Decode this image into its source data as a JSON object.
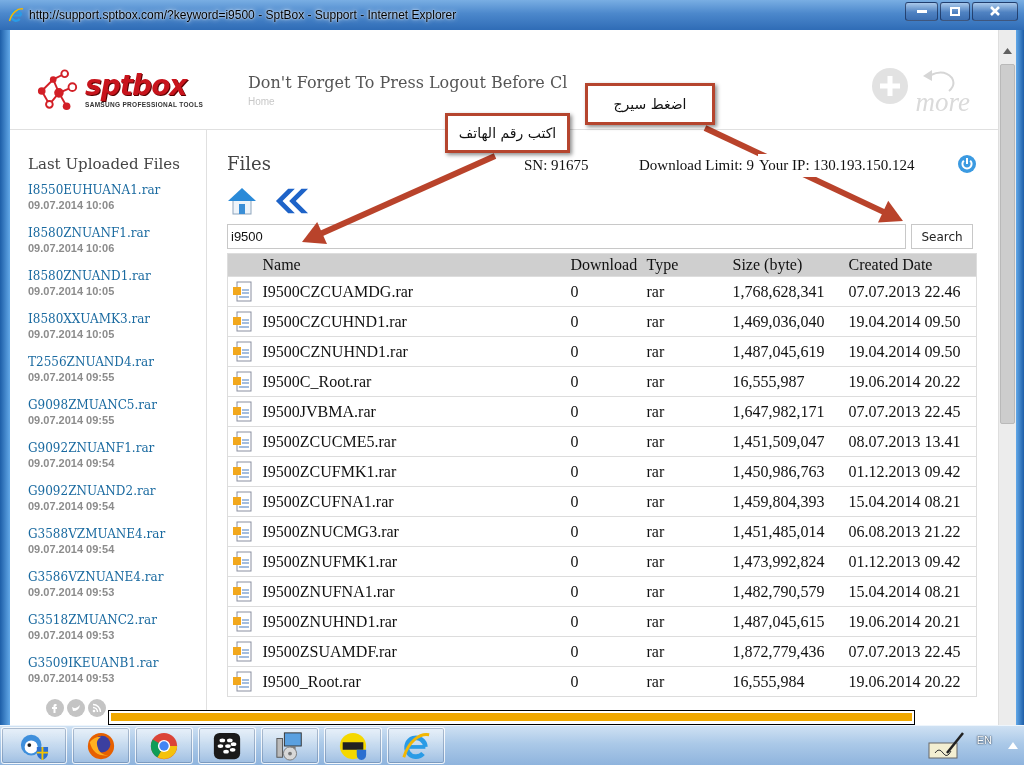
{
  "window": {
    "title": "http://support.sptbox.com/?keyword=i9500 - SptBox - Support - Internet Explorer"
  },
  "header": {
    "logo_text": "sptbox",
    "logo_tagline": "SAMSUNG PROFESSIONAL TOOLS",
    "notice": "Don't Forget To Press Logout Before Cl",
    "breadcrumb": "Home",
    "more_label": "more"
  },
  "sidebar": {
    "title": "Last Uploaded Files",
    "items": [
      {
        "name": "I8550EUHUANA1.rar",
        "date": "09.07.2014 10:06"
      },
      {
        "name": "I8580ZNUANF1.rar",
        "date": "09.07.2014 10:06"
      },
      {
        "name": "I8580ZNUAND1.rar",
        "date": "09.07.2014 10:05"
      },
      {
        "name": "I8580XXUAMK3.rar",
        "date": "09.07.2014 10:05"
      },
      {
        "name": "T2556ZNUAND4.rar",
        "date": "09.07.2014 09:55"
      },
      {
        "name": "G9098ZMUANC5.rar",
        "date": "09.07.2014 09:55"
      },
      {
        "name": "G9092ZNUANF1.rar",
        "date": "09.07.2014 09:54"
      },
      {
        "name": "G9092ZNUAND2.rar",
        "date": "09.07.2014 09:54"
      },
      {
        "name": "G3588VZMUANE4.rar",
        "date": "09.07.2014 09:54"
      },
      {
        "name": "G3586VZNUANE4.rar",
        "date": "09.07.2014 09:53"
      },
      {
        "name": "G3518ZMUANC2.rar",
        "date": "09.07.2014 09:53"
      },
      {
        "name": "G3509IKEUANB1.rar",
        "date": "09.07.2014 09:53"
      }
    ]
  },
  "main": {
    "title": "Files",
    "serial": "SN: 91675",
    "download_limit": "Download Limit: 9",
    "ip": "Your IP: 130.193.150.124",
    "search": {
      "value": "i9500",
      "button": "Search"
    }
  },
  "table": {
    "columns": [
      "Name",
      "Download",
      "Type",
      "Size (byte)",
      "Created Date"
    ],
    "rows": [
      {
        "name": "I9500CZCUAMDG.rar",
        "downloads": "0",
        "type": "rar",
        "size": "1,768,628,341",
        "created": "07.07.2013 22.46"
      },
      {
        "name": "I9500CZCUHND1.rar",
        "downloads": "0",
        "type": "rar",
        "size": "1,469,036,040",
        "created": "19.04.2014 09.50"
      },
      {
        "name": "I9500CZNUHND1.rar",
        "downloads": "0",
        "type": "rar",
        "size": "1,487,045,619",
        "created": "19.04.2014 09.50"
      },
      {
        "name": "I9500C_Root.rar",
        "downloads": "0",
        "type": "rar",
        "size": "16,555,987",
        "created": "19.06.2014 20.22"
      },
      {
        "name": "I9500JVBMA.rar",
        "downloads": "0",
        "type": "rar",
        "size": "1,647,982,171",
        "created": "07.07.2013 22.45"
      },
      {
        "name": "I9500ZCUCME5.rar",
        "downloads": "0",
        "type": "rar",
        "size": "1,451,509,047",
        "created": "08.07.2013 13.41"
      },
      {
        "name": "I9500ZCUFMK1.rar",
        "downloads": "0",
        "type": "rar",
        "size": "1,450,986,763",
        "created": "01.12.2013 09.42"
      },
      {
        "name": "I9500ZCUFNA1.rar",
        "downloads": "0",
        "type": "rar",
        "size": "1,459,804,393",
        "created": "15.04.2014 08.21"
      },
      {
        "name": "I9500ZNUCMG3.rar",
        "downloads": "0",
        "type": "rar",
        "size": "1,451,485,014",
        "created": "06.08.2013 21.22"
      },
      {
        "name": "I9500ZNUFMK1.rar",
        "downloads": "0",
        "type": "rar",
        "size": "1,473,992,824",
        "created": "01.12.2013 09.42"
      },
      {
        "name": "I9500ZNUFNA1.rar",
        "downloads": "0",
        "type": "rar",
        "size": "1,482,790,579",
        "created": "15.04.2014 08.21"
      },
      {
        "name": "I9500ZNUHND1.rar",
        "downloads": "0",
        "type": "rar",
        "size": "1,487,045,615",
        "created": "19.06.2014 20.21"
      },
      {
        "name": "I9500ZSUAMDF.rar",
        "downloads": "0",
        "type": "rar",
        "size": "1,872,779,436",
        "created": "07.07.2013 22.45"
      },
      {
        "name": "I9500_Root.rar",
        "downloads": "0",
        "type": "rar",
        "size": "16,555,984",
        "created": "19.06.2014 20.22"
      }
    ]
  },
  "annotations": [
    {
      "text": "اضغط سيرج"
    },
    {
      "text": "اكتب رقم الهاتف"
    }
  ],
  "taskbar": {
    "apps": [
      {
        "kind": "messenger"
      },
      {
        "kind": "firefox"
      },
      {
        "kind": "chrome"
      },
      {
        "kind": "blackberry"
      },
      {
        "kind": "installer"
      },
      {
        "kind": "sptool"
      },
      {
        "kind": "ie"
      }
    ],
    "language": "EN"
  }
}
